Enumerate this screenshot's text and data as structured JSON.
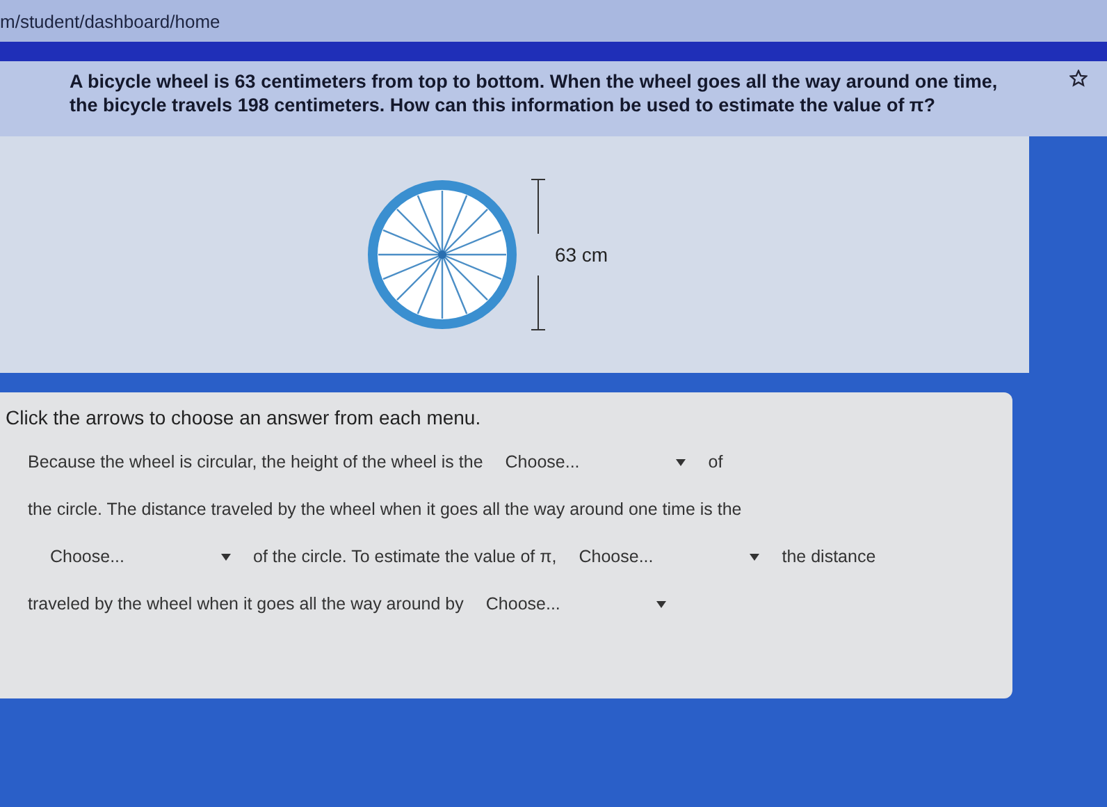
{
  "browser": {
    "url": "m/student/dashboard/home"
  },
  "question": {
    "text": "A bicycle wheel is 63 centimeters from top to bottom. When the wheel goes all the way around one time, the bicycle travels 198 centimeters. How can this information be used to estimate the value of π?"
  },
  "figure": {
    "measurement": "63 cm"
  },
  "answer": {
    "instructions": "Click the arrows to choose an answer from each menu.",
    "lines": [
      [
        {
          "kind": "text",
          "text": "Because the wheel is circular, the height of the wheel is the"
        },
        {
          "kind": "dropdown",
          "text": "Choose..."
        },
        {
          "kind": "text",
          "text": "of"
        }
      ],
      [
        {
          "kind": "text",
          "text": "the circle. The distance traveled by the wheel when it goes all the way around one time is the"
        }
      ],
      [
        {
          "kind": "dropdown",
          "text": "Choose..."
        },
        {
          "kind": "text",
          "text": "of the circle. To estimate the value of π,"
        },
        {
          "kind": "dropdown",
          "text": "Choose..."
        },
        {
          "kind": "text",
          "text": "the distance"
        }
      ],
      [
        {
          "kind": "text",
          "text": "traveled by the wheel when it goes all the way around by"
        },
        {
          "kind": "dropdown",
          "text": "Choose..."
        }
      ]
    ]
  }
}
